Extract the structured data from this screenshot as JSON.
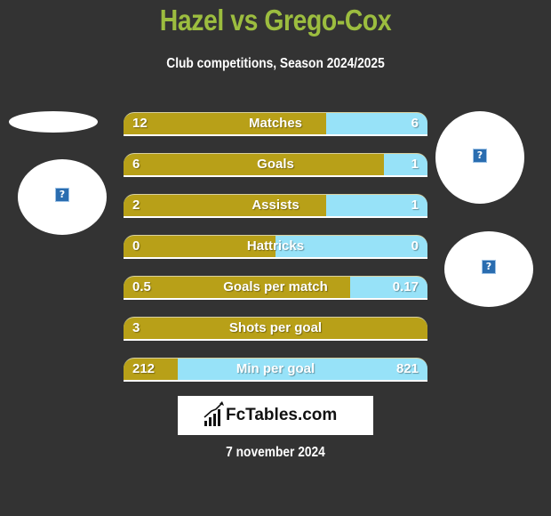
{
  "header": {
    "title": "Hazel vs Grego-Cox",
    "subtitle": "Club competitions, Season 2024/2025"
  },
  "colors": {
    "left_player": "#b8a018",
    "right_player": "#97e2f8",
    "title": "#9cbd3f",
    "background": "#333333"
  },
  "placeholder_icon": "?",
  "stats": [
    {
      "label": "Matches",
      "left": "12",
      "right": "6",
      "left_share": 0.667
    },
    {
      "label": "Goals",
      "left": "6",
      "right": "1",
      "left_share": 0.857
    },
    {
      "label": "Assists",
      "left": "2",
      "right": "1",
      "left_share": 0.667
    },
    {
      "label": "Hattricks",
      "left": "0",
      "right": "0",
      "left_share": 0.5
    },
    {
      "label": "Goals per match",
      "left": "0.5",
      "right": "0.17",
      "left_share": 0.746
    },
    {
      "label": "Shots per goal",
      "left": "3",
      "right": "",
      "left_share": 1.0
    },
    {
      "label": "Min per goal",
      "left": "212",
      "right": "821",
      "left_share": 0.178
    }
  ],
  "footer": {
    "logo_text": "FcTables.com",
    "date": "7 november 2024"
  }
}
